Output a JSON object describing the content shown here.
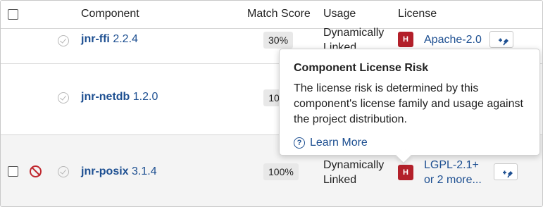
{
  "header": {
    "component": "Component",
    "match_score": "Match Score",
    "usage": "Usage",
    "license": "License"
  },
  "rows": [
    {
      "name": "jnr-ffi",
      "version": "2.2.4",
      "score": "30%",
      "usage_line1": "Dynamically",
      "usage_line2": "Linked",
      "risk": "H",
      "license_line1": "Apache-2.0",
      "license_line2": ""
    },
    {
      "name": "jnr-netdb",
      "version": "1.2.0",
      "score": "10",
      "usage_line1": "",
      "usage_line2": "",
      "risk": "",
      "license_line1": "",
      "license_line2": ""
    },
    {
      "name": "jnr-posix",
      "version": "3.1.4",
      "score": "100%",
      "usage_line1": "Dynamically",
      "usage_line2": "Linked",
      "risk": "H",
      "license_line1": "LGPL-2.1+",
      "license_line2": "or 2 more..."
    }
  ],
  "tooltip": {
    "title": "Component License Risk",
    "body": "The license risk is determined by this component's license family and usage against the project distribution.",
    "learn_more": "Learn More",
    "help_icon_glyph": "?"
  },
  "icons": {
    "ok": "check-circle-icon",
    "ignored": "ban-icon",
    "pin": "pin-icon"
  },
  "colors": {
    "link": "#1d4f91",
    "risk_high": "#b3202a",
    "ban": "#c0282f"
  }
}
